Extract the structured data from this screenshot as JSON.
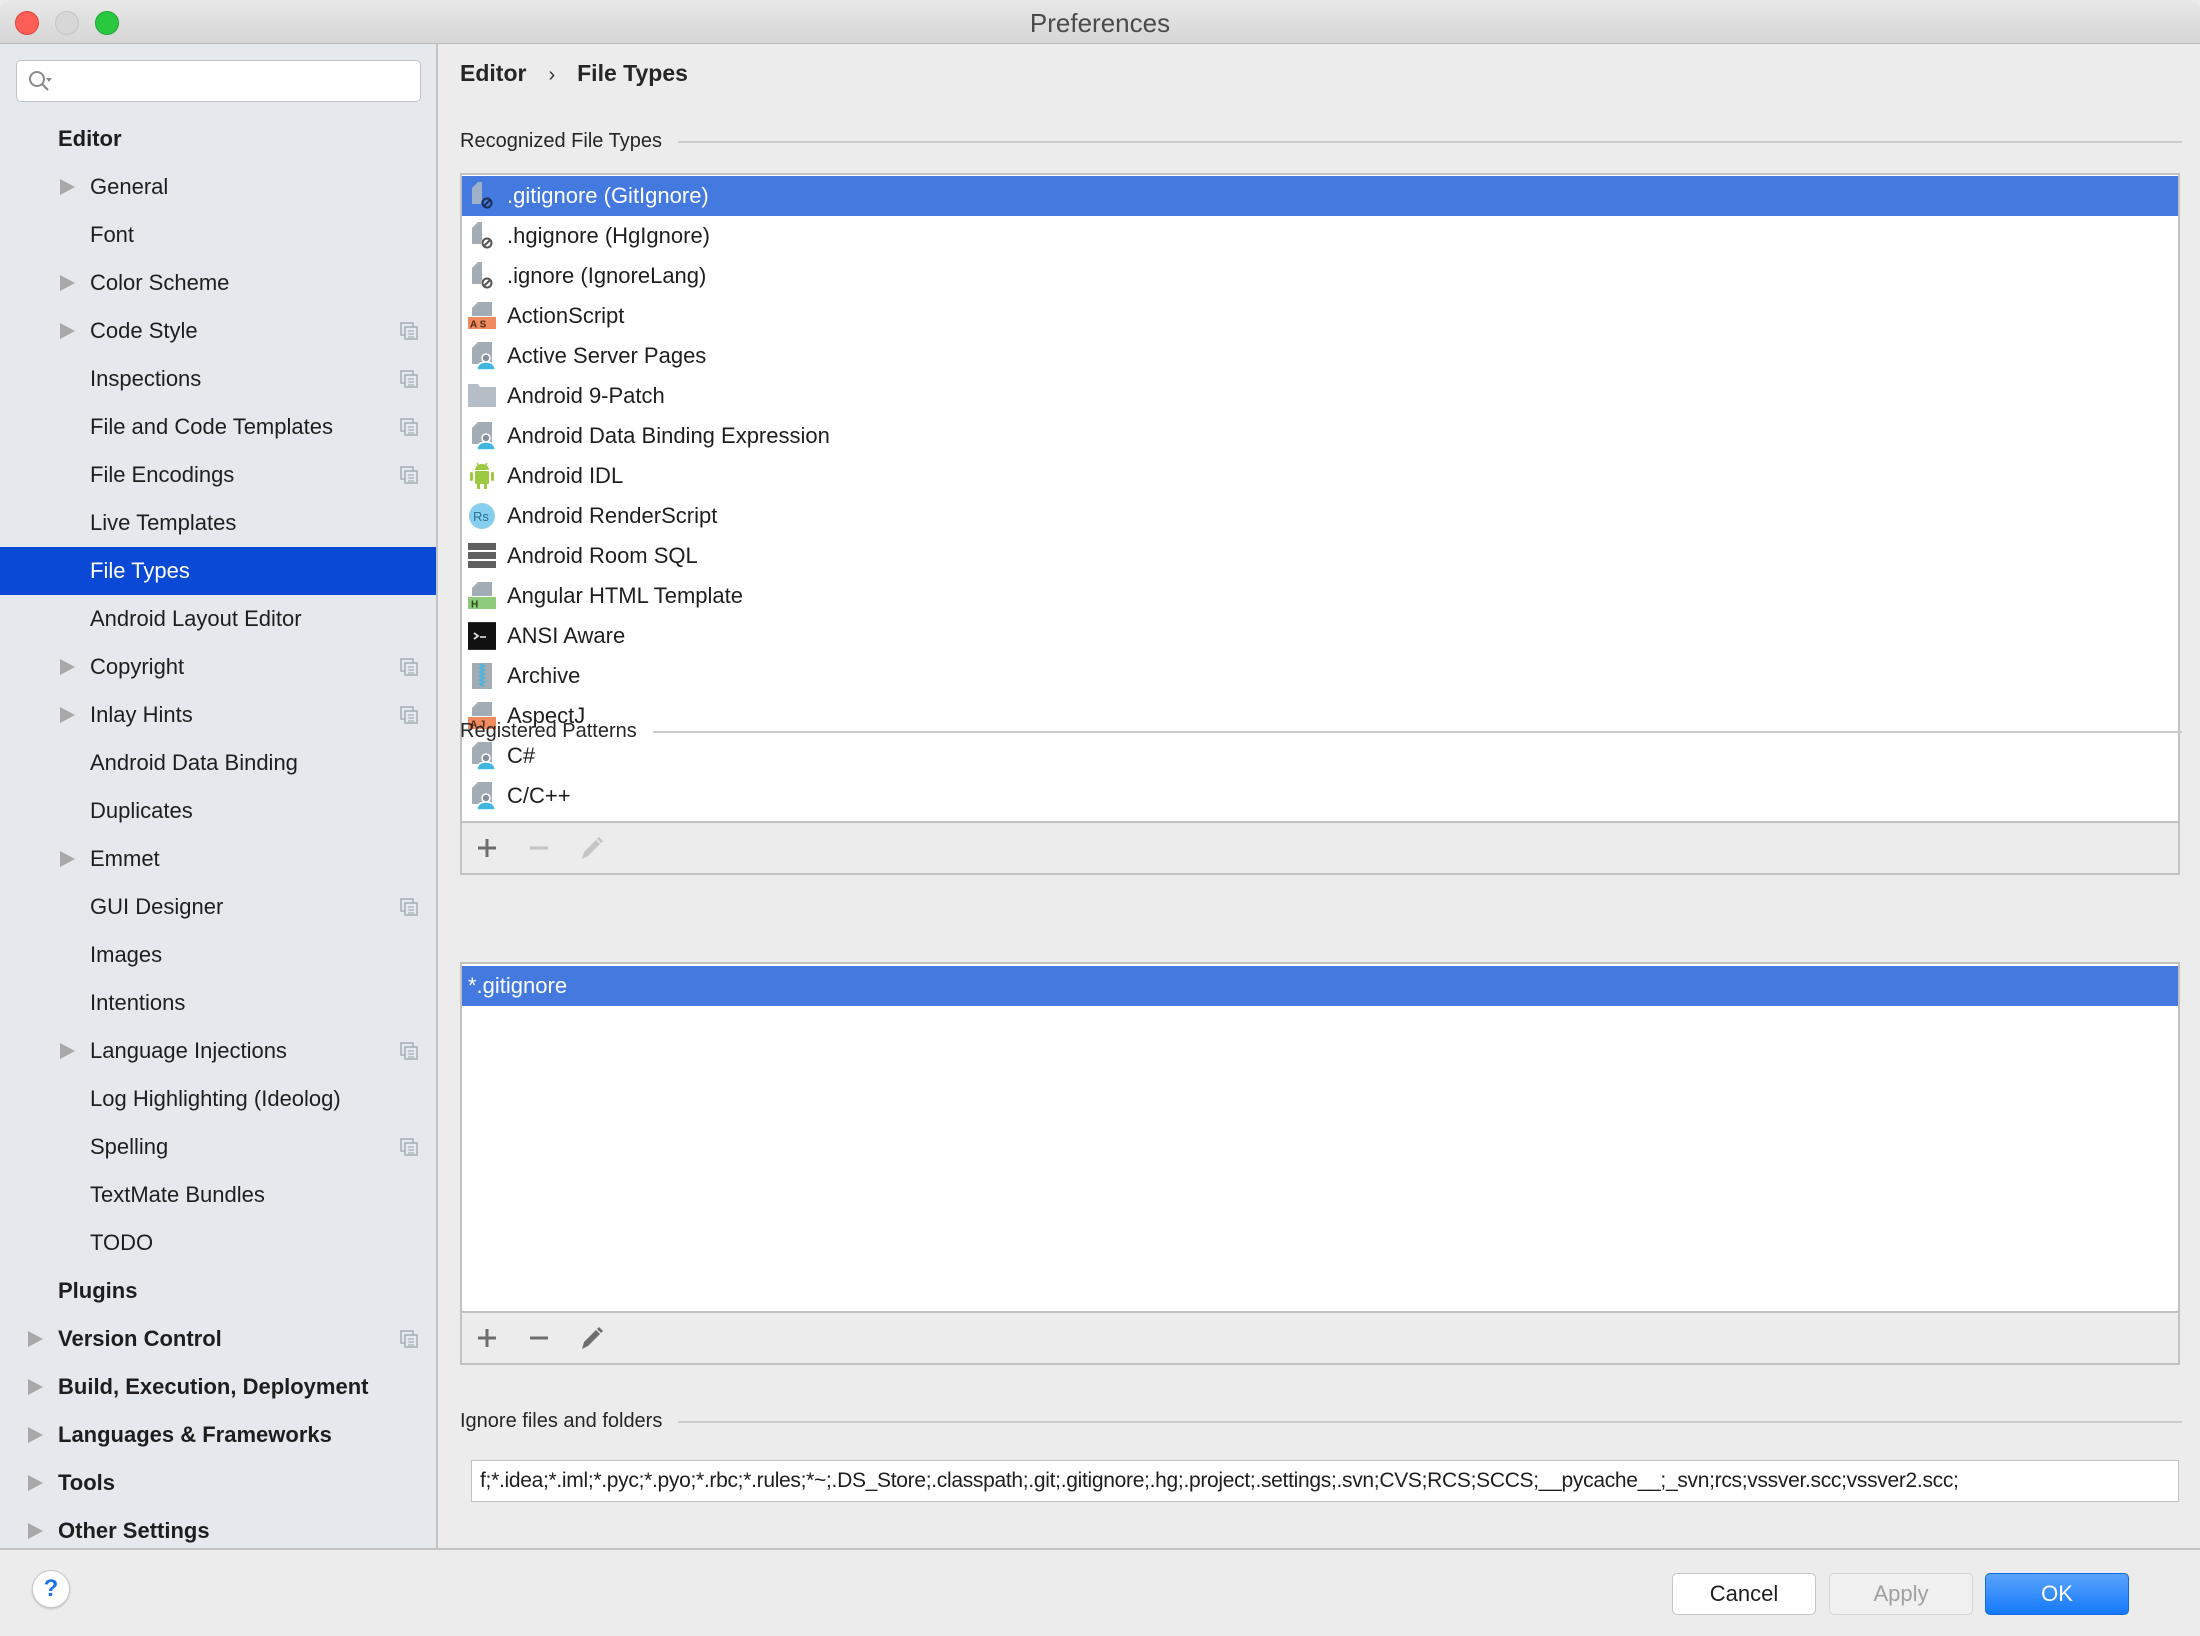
{
  "window": {
    "title": "Preferences"
  },
  "search": {
    "placeholder": "",
    "value": ""
  },
  "sidebar": {
    "items": [
      {
        "label": "Editor",
        "level": 0,
        "expandable": false,
        "project_icon": false,
        "selected": false
      },
      {
        "label": "General",
        "level": 1,
        "expandable": true,
        "project_icon": false,
        "selected": false
      },
      {
        "label": "Font",
        "level": 1,
        "expandable": false,
        "project_icon": false,
        "selected": false
      },
      {
        "label": "Color Scheme",
        "level": 1,
        "expandable": true,
        "project_icon": false,
        "selected": false
      },
      {
        "label": "Code Style",
        "level": 1,
        "expandable": true,
        "project_icon": true,
        "selected": false
      },
      {
        "label": "Inspections",
        "level": 1,
        "expandable": false,
        "project_icon": true,
        "selected": false
      },
      {
        "label": "File and Code Templates",
        "level": 1,
        "expandable": false,
        "project_icon": true,
        "selected": false
      },
      {
        "label": "File Encodings",
        "level": 1,
        "expandable": false,
        "project_icon": true,
        "selected": false
      },
      {
        "label": "Live Templates",
        "level": 1,
        "expandable": false,
        "project_icon": false,
        "selected": false
      },
      {
        "label": "File Types",
        "level": 1,
        "expandable": false,
        "project_icon": false,
        "selected": true
      },
      {
        "label": "Android Layout Editor",
        "level": 1,
        "expandable": false,
        "project_icon": false,
        "selected": false
      },
      {
        "label": "Copyright",
        "level": 1,
        "expandable": true,
        "project_icon": true,
        "selected": false
      },
      {
        "label": "Inlay Hints",
        "level": 1,
        "expandable": true,
        "project_icon": true,
        "selected": false
      },
      {
        "label": "Android Data Binding",
        "level": 1,
        "expandable": false,
        "project_icon": false,
        "selected": false
      },
      {
        "label": "Duplicates",
        "level": 1,
        "expandable": false,
        "project_icon": false,
        "selected": false
      },
      {
        "label": "Emmet",
        "level": 1,
        "expandable": true,
        "project_icon": false,
        "selected": false
      },
      {
        "label": "GUI Designer",
        "level": 1,
        "expandable": false,
        "project_icon": true,
        "selected": false
      },
      {
        "label": "Images",
        "level": 1,
        "expandable": false,
        "project_icon": false,
        "selected": false
      },
      {
        "label": "Intentions",
        "level": 1,
        "expandable": false,
        "project_icon": false,
        "selected": false
      },
      {
        "label": "Language Injections",
        "level": 1,
        "expandable": true,
        "project_icon": true,
        "selected": false
      },
      {
        "label": "Log Highlighting (Ideolog)",
        "level": 1,
        "expandable": false,
        "project_icon": false,
        "selected": false
      },
      {
        "label": "Spelling",
        "level": 1,
        "expandable": false,
        "project_icon": true,
        "selected": false
      },
      {
        "label": "TextMate Bundles",
        "level": 1,
        "expandable": false,
        "project_icon": false,
        "selected": false
      },
      {
        "label": "TODO",
        "level": 1,
        "expandable": false,
        "project_icon": false,
        "selected": false
      },
      {
        "label": "Plugins",
        "level": 0,
        "expandable": false,
        "project_icon": false,
        "selected": false
      },
      {
        "label": "Version Control",
        "level": 0,
        "expandable": true,
        "project_icon": true,
        "selected": false
      },
      {
        "label": "Build, Execution, Deployment",
        "level": 0,
        "expandable": true,
        "project_icon": false,
        "selected": false
      },
      {
        "label": "Languages & Frameworks",
        "level": 0,
        "expandable": true,
        "project_icon": false,
        "selected": false
      },
      {
        "label": "Tools",
        "level": 0,
        "expandable": true,
        "project_icon": false,
        "selected": false
      },
      {
        "label": "Other Settings",
        "level": 0,
        "expandable": true,
        "project_icon": false,
        "selected": false
      }
    ]
  },
  "breadcrumb": {
    "parent": "Editor",
    "separator": "›",
    "current": "File Types"
  },
  "recognized": {
    "label": "Recognized File Types",
    "items": [
      {
        "label": ".gitignore (GitIgnore)",
        "icon": "ignore-file-icon",
        "selected": true
      },
      {
        "label": ".hgignore (HgIgnore)",
        "icon": "ignore-file-icon",
        "selected": false
      },
      {
        "label": ".ignore (IgnoreLang)",
        "icon": "ignore-file-icon",
        "selected": false
      },
      {
        "label": "ActionScript",
        "icon": "actionscript-file-icon",
        "badge": "AS",
        "selected": false
      },
      {
        "label": "Active Server Pages",
        "icon": "custom-file-icon",
        "selected": false
      },
      {
        "label": "Android 9-Patch",
        "icon": "folder-icon",
        "selected": false
      },
      {
        "label": "Android Data Binding Expression",
        "icon": "custom-file-icon",
        "selected": false
      },
      {
        "label": "Android IDL",
        "icon": "android-icon",
        "selected": false
      },
      {
        "label": "Android RenderScript",
        "icon": "renderscript-icon",
        "badge": "Rs",
        "selected": false
      },
      {
        "label": "Android Room SQL",
        "icon": "database-icon",
        "selected": false
      },
      {
        "label": "Angular HTML Template",
        "icon": "html-file-icon",
        "badge": "H",
        "selected": false
      },
      {
        "label": "ANSI Aware",
        "icon": "terminal-icon",
        "selected": false
      },
      {
        "label": "Archive",
        "icon": "archive-icon",
        "selected": false
      },
      {
        "label": "AspectJ",
        "icon": "aspectj-file-icon",
        "badge": "AJ",
        "selected": false
      },
      {
        "label": "C#",
        "icon": "custom-file-icon",
        "selected": false
      },
      {
        "label": "C/C++",
        "icon": "custom-file-icon",
        "selected": false
      }
    ]
  },
  "patterns": {
    "label": "Registered Patterns",
    "items": [
      {
        "label": "*.gitignore",
        "selected": true
      }
    ]
  },
  "toolbar": {
    "add": "+",
    "remove": "−",
    "edit": "edit"
  },
  "ignore": {
    "label": "Ignore files and folders",
    "value": "f;*.idea;*.iml;*.pyc;*.pyo;*.rbc;*.rules;*~;.DS_Store;.classpath;.git;.gitignore;.hg;.project;.settings;.svn;CVS;RCS;SCCS;__pycache__;_svn;rcs;vssver.scc;vssver2.scc;"
  },
  "footer": {
    "help": "?",
    "cancel": "Cancel",
    "apply": "Apply",
    "ok": "OK"
  },
  "colors": {
    "selection_sidebar": "#0a48d6",
    "selection_list": "#4479e0",
    "ok_button": "#1579fb"
  }
}
